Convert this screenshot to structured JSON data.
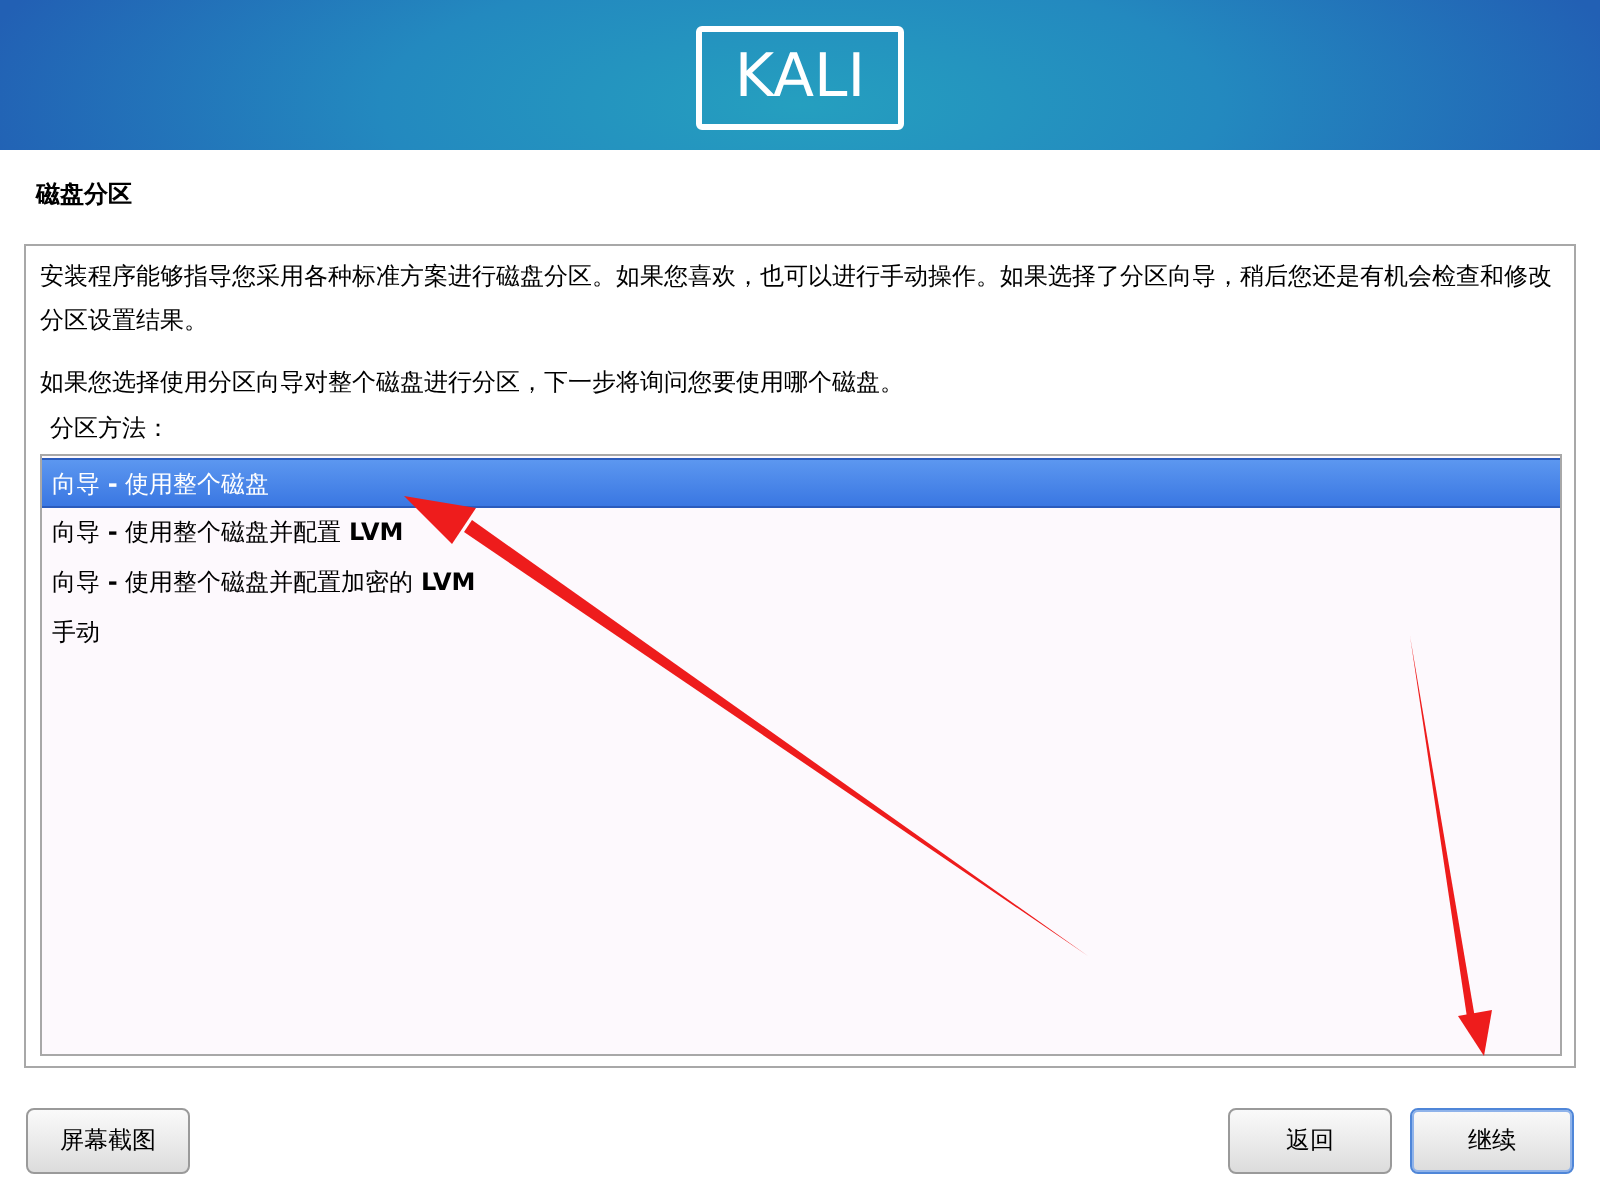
{
  "header": {
    "logo": "KALI"
  },
  "title": "磁盘分区",
  "paragraphs": [
    "安装程序能够指导您采用各种标准方案进行磁盘分区。如果您喜欢，也可以进行手动操作。如果选择了分区向导，稍后您还是有机会检查和修改分区设置结果。",
    "如果您选择使用分区向导对整个磁盘进行分区，下一步将询问您要使用哪个磁盘。"
  ],
  "list_label": "分区方法：",
  "methods": [
    {
      "label": "向导 **-** 使用整个磁盘",
      "selected": true
    },
    {
      "label": "向导 **-** 使用整个磁盘并配置 **LVM**",
      "selected": false
    },
    {
      "label": "向导 **-** 使用整个磁盘并配置加密的 **LVM**",
      "selected": false
    },
    {
      "label": "手动",
      "selected": false
    }
  ],
  "buttons": [
    {
      "label": "屏幕截图",
      "focused": false,
      "kind": "left"
    },
    {
      "label": "返回",
      "focused": false,
      "kind": "right"
    },
    {
      "label": "继续",
      "focused": true,
      "kind": "right"
    }
  ]
}
